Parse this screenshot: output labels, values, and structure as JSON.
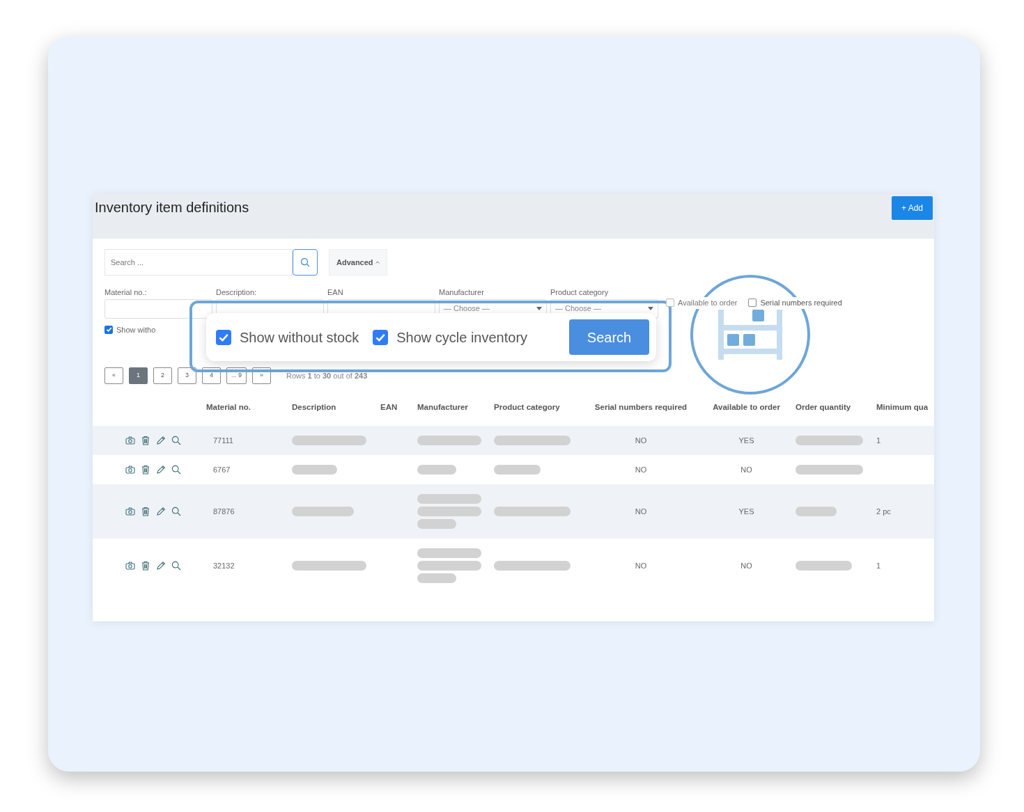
{
  "page": {
    "title": "Inventory item definitions",
    "add_button": {
      "icon": "+",
      "label": "Add"
    }
  },
  "search": {
    "placeholder": "Search ...",
    "advanced_button": "Advanced",
    "advanced_expanded": true
  },
  "filters": [
    {
      "kind": "text",
      "label": "Material no.:"
    },
    {
      "kind": "text",
      "label": "Description:"
    },
    {
      "kind": "text",
      "label": "EAN"
    },
    {
      "kind": "select",
      "label": "Manufacturer",
      "value": "— Choose —"
    },
    {
      "kind": "select",
      "label": "Product category",
      "value": "— Choose —"
    }
  ],
  "checkboxes": [
    {
      "label": "Available to order",
      "checked": false,
      "disabled": true
    },
    {
      "label": "Serial numbers required",
      "checked": false,
      "disabled": false
    }
  ],
  "show_checkbox": {
    "label": "Show witho",
    "checked": true
  },
  "pagination": {
    "pages": [
      {
        "label": "«",
        "selected": false
      },
      {
        "label": "1",
        "selected": true
      },
      {
        "label": "2",
        "selected": false
      },
      {
        "label": "3",
        "selected": false
      },
      {
        "label": "4",
        "selected": false
      },
      {
        "label": "... 9",
        "selected": false
      },
      {
        "label": "»",
        "selected": false
      }
    ],
    "summary": "Rows **1** to **30** out of **243**"
  },
  "table": {
    "columns": [
      "Material no.",
      "Description",
      "EAN",
      "Manufacturer",
      "Product category",
      "Serial numbers required",
      "Available to order",
      "Order quantity",
      "Minimum qua"
    ],
    "rows": [
      {
        "cells": [
          {
            "kind": "text",
            "text": "77111"
          },
          {
            "kind": "redacted",
            "lines": [
              {
                "kind": "long"
              }
            ]
          },
          {
            "kind": "empty"
          },
          {
            "kind": "redacted",
            "lines": [
              {
                "kind": "long"
              }
            ]
          },
          {
            "kind": "redacted",
            "lines": [
              {
                "kind": "long"
              }
            ]
          },
          {
            "kind": "text",
            "text": "NO"
          },
          {
            "kind": "text",
            "text": "YES"
          },
          {
            "kind": "redacted",
            "lines": [
              {
                "kind": "long"
              }
            ]
          },
          {
            "kind": "text",
            "text": "1"
          }
        ]
      },
      {
        "cells": [
          {
            "kind": "text",
            "text": "6767"
          },
          {
            "kind": "redacted",
            "lines": [
              {
                "kind": "short"
              }
            ]
          },
          {
            "kind": "empty"
          },
          {
            "kind": "redacted",
            "lines": [
              {
                "kind": "short"
              }
            ]
          },
          {
            "kind": "redacted",
            "lines": [
              {
                "kind": "short"
              }
            ]
          },
          {
            "kind": "text",
            "text": "NO"
          },
          {
            "kind": "text",
            "text": "NO"
          },
          {
            "kind": "redacted",
            "lines": [
              {
                "kind": "long"
              }
            ]
          },
          {
            "kind": "empty"
          }
        ]
      },
      {
        "cells": [
          {
            "kind": "text",
            "text": "87876"
          },
          {
            "kind": "redacted",
            "lines": [
              {
                "kind": "medium"
              }
            ]
          },
          {
            "kind": "empty"
          },
          {
            "kind": "redacted",
            "lines": [
              {
                "kind": "long"
              },
              {
                "kind": "long"
              },
              {
                "kind": "short"
              }
            ]
          },
          {
            "kind": "redacted",
            "lines": [
              {
                "kind": "long"
              }
            ]
          },
          {
            "kind": "text",
            "text": "NO"
          },
          {
            "kind": "text",
            "text": "YES"
          },
          {
            "kind": "redacted",
            "lines": [
              {
                "kind": "short"
              }
            ]
          },
          {
            "kind": "text",
            "text": "2 pc"
          }
        ]
      },
      {
        "cells": [
          {
            "kind": "text",
            "text": "32132"
          },
          {
            "kind": "redacted",
            "lines": [
              {
                "kind": "long"
              }
            ]
          },
          {
            "kind": "empty"
          },
          {
            "kind": "redacted",
            "lines": [
              {
                "kind": "long"
              },
              {
                "kind": "long"
              },
              {
                "kind": "short"
              }
            ]
          },
          {
            "kind": "redacted",
            "lines": [
              {
                "kind": "long"
              }
            ]
          },
          {
            "kind": "text",
            "text": "NO"
          },
          {
            "kind": "text",
            "text": "NO"
          },
          {
            "kind": "redacted",
            "lines": [
              {
                "kind": "medium"
              }
            ]
          },
          {
            "kind": "text",
            "text": "1"
          }
        ]
      }
    ]
  },
  "callout": {
    "checkboxes": [
      {
        "label": "Show without stock",
        "checked": true
      },
      {
        "label": "Show cycle inventory",
        "checked": true
      }
    ],
    "button": "Search"
  }
}
